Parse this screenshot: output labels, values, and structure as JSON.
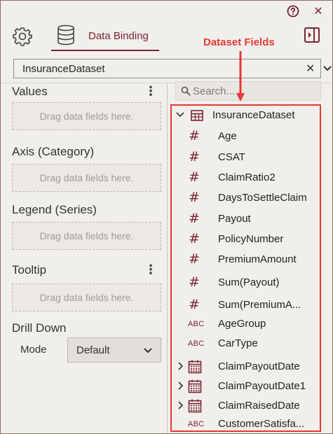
{
  "window": {
    "help_icon": "question-circle-icon",
    "close_label": "✕"
  },
  "tabs": {
    "data_binding_label": "Data Binding"
  },
  "dataset_select": {
    "value": "InsuranceDataset",
    "clear_label": "✕"
  },
  "sections": {
    "values": {
      "title": "Values",
      "placeholder": "Drag data fields here."
    },
    "axis": {
      "title": "Axis (Category)",
      "placeholder": "Drag data fields here."
    },
    "legend": {
      "title": "Legend (Series)",
      "placeholder": "Drag data fields here."
    },
    "tooltip": {
      "title": "Tooltip",
      "placeholder": "Drag data fields here."
    },
    "drill_down": {
      "title": "Drill Down",
      "mode_label": "Mode",
      "mode_value": "Default"
    }
  },
  "search": {
    "placeholder": "Search..."
  },
  "annotation": {
    "label": "Dataset Fields",
    "color": "#e53935"
  },
  "fields": {
    "root": "InsuranceDataset",
    "items": [
      {
        "type": "number",
        "name": "Age"
      },
      {
        "type": "number",
        "name": "CSAT"
      },
      {
        "type": "number",
        "name": "ClaimRatio2"
      },
      {
        "type": "number",
        "name": "DaysToSettleClaim"
      },
      {
        "type": "number",
        "name": "Payout"
      },
      {
        "type": "number",
        "name": "PolicyNumber"
      },
      {
        "type": "number",
        "name": "PremiumAmount"
      },
      {
        "type": "number",
        "name": "Sum(Payout)"
      },
      {
        "type": "number",
        "name": "Sum(PremiumA..."
      },
      {
        "type": "text",
        "name": "AgeGroup"
      },
      {
        "type": "text",
        "name": "CarType"
      },
      {
        "type": "date",
        "name": "ClaimPayoutDate"
      },
      {
        "type": "date",
        "name": "ClaimPayoutDate1"
      },
      {
        "type": "date",
        "name": "ClaimRaisedDate"
      },
      {
        "type": "text",
        "name": "CustomerSatisfa..."
      }
    ]
  },
  "colors": {
    "accent": "#7a2431",
    "panel": "#f1efec",
    "highlight": "#e53935"
  }
}
